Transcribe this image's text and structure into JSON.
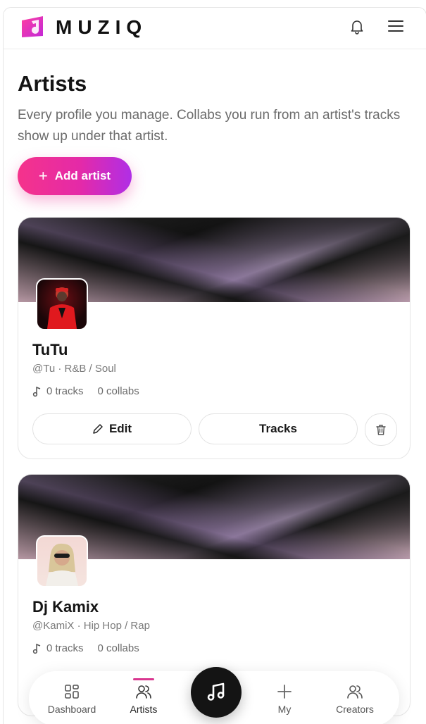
{
  "header": {
    "brand": "MUZIQ"
  },
  "page": {
    "title": "Artists",
    "subtitle": "Every profile you manage. Collabs you run from an artist's tracks show up under that artist.",
    "add_button_label": "Add artist"
  },
  "artists": [
    {
      "name": "TuTu",
      "meta": "@Tu · R&B / Soul",
      "tracks": "0 tracks",
      "collabs": "0 collabs",
      "edit_label": "Edit",
      "tracks_label": "Tracks"
    },
    {
      "name": "Dj Kamix",
      "meta": "@KamiX · Hip Hop / Rap",
      "tracks": "0 tracks",
      "collabs": "0 collabs"
    }
  ],
  "nav": {
    "dashboard": "Dashboard",
    "artists": "Artists",
    "my": "My",
    "creators": "Creators"
  },
  "colors": {
    "accent_pink": "#f5338b",
    "accent_purple": "#b02ee6",
    "nav_indicator": "#d9368f"
  },
  "icons": [
    "music-note-logo-icon",
    "bell-icon",
    "hamburger-menu-icon",
    "plus-icon",
    "music-note-icon",
    "pencil-icon",
    "trash-icon",
    "grid-icon",
    "users-icon",
    "music-note-fab-icon"
  ]
}
